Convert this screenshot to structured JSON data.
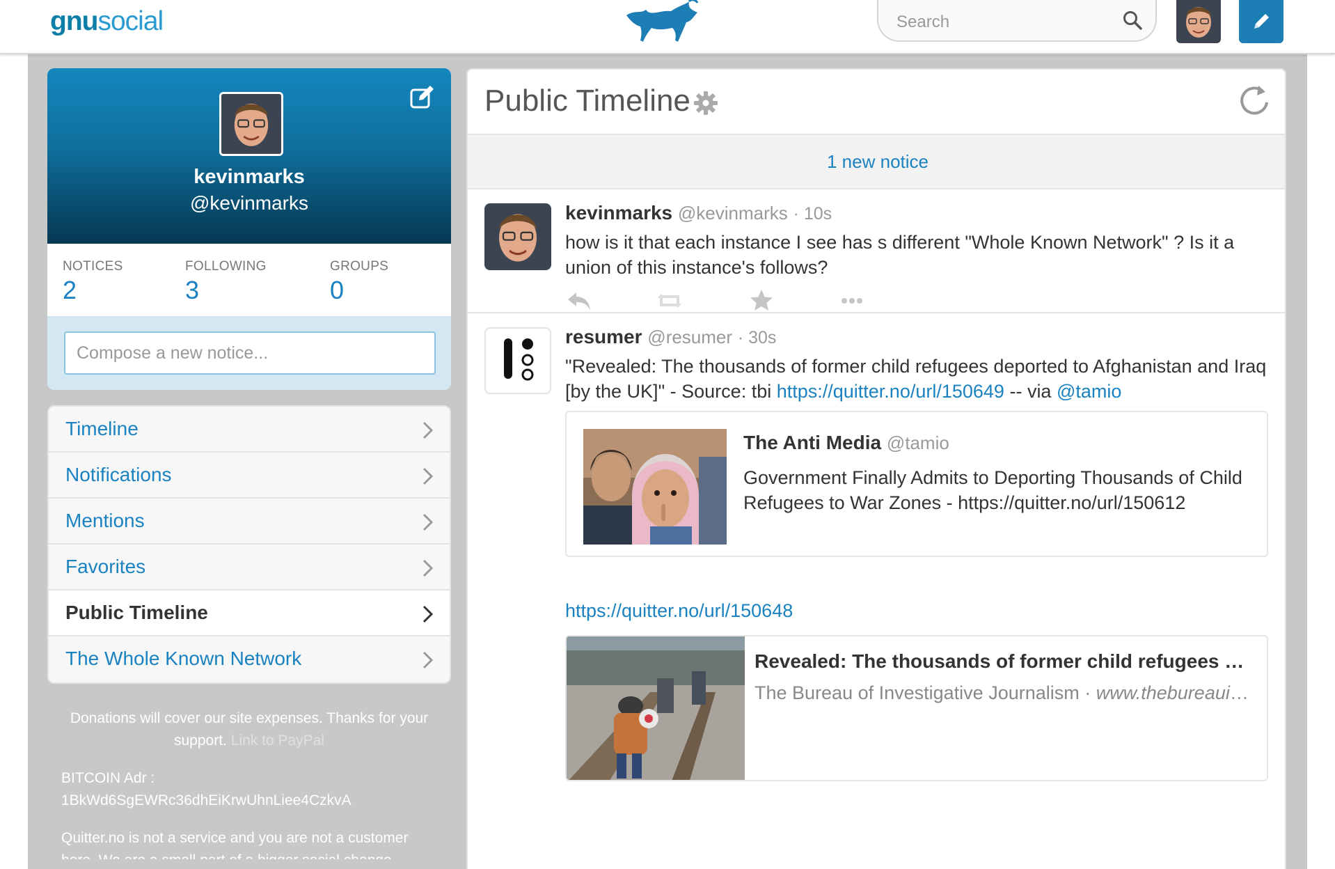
{
  "header": {
    "logo_gnu": "gnu",
    "logo_social": "social",
    "search_placeholder": "Search"
  },
  "profile": {
    "name": "kevinmarks",
    "handle": "@kevinmarks",
    "stats": [
      {
        "label": "NOTICES",
        "value": "2"
      },
      {
        "label": "FOLLOWING",
        "value": "3"
      },
      {
        "label": "GROUPS",
        "value": "0"
      }
    ],
    "compose_placeholder": "Compose a new notice..."
  },
  "nav": {
    "items": [
      {
        "label": "Timeline",
        "active": false
      },
      {
        "label": "Notifications",
        "active": false
      },
      {
        "label": "Mentions",
        "active": false
      },
      {
        "label": "Favorites",
        "active": false
      },
      {
        "label": "Public Timeline",
        "active": true
      },
      {
        "label": "The Whole Known Network",
        "active": false
      }
    ]
  },
  "footer": {
    "donate_text": "Donations will cover our site expenses. Thanks for your support.",
    "paypal_link": "Link to PayPal",
    "bitcoin_label": "BITCOIN Adr :",
    "bitcoin_address": "1BkWd6SgEWRc36dhEiKrwUhnLiee4CzkvA",
    "about_text": "Quitter.no is not a service and you are not a customer here. We are a small part of a bigger social change."
  },
  "main": {
    "title": "Public Timeline",
    "new_notice_label": "1 new notice",
    "notices": [
      {
        "name": "kevinmarks",
        "handle": "@kevinmarks",
        "time": "· 10s",
        "text": "how is it that each instance I see has s different \"Whole Known Network\" ? Is it a union of this instance's follows?"
      },
      {
        "name": "resumer",
        "handle": "@resumer",
        "time": "· 30s",
        "text_start": "\"Revealed: The thousands of former child refugees deported to Afghanistan and Iraq [by the UK]\" - Source: tbi ",
        "link1": "https://quitter.no/url/150649",
        "text_mid": " -- via ",
        "mention": "@tamio",
        "quote": {
          "name": "The Anti Media",
          "handle": "@tamio",
          "text": "Government Finally Admits to Deporting Thousands of Child Refugees to War Zones - https://quitter.no/url/150612"
        },
        "link2": "https://quitter.no/url/150648",
        "card": {
          "title": "Revealed: The thousands of former child refugees deported to Afghanistan and Iraq",
          "source": "The Bureau of Investigative Journalism · ",
          "site": "www.thebureauinvestigates.com"
        }
      }
    ]
  },
  "colors": {
    "brand": "#0c7ea8",
    "link": "#1a82c0",
    "page_bg": "#c8c8c8"
  }
}
